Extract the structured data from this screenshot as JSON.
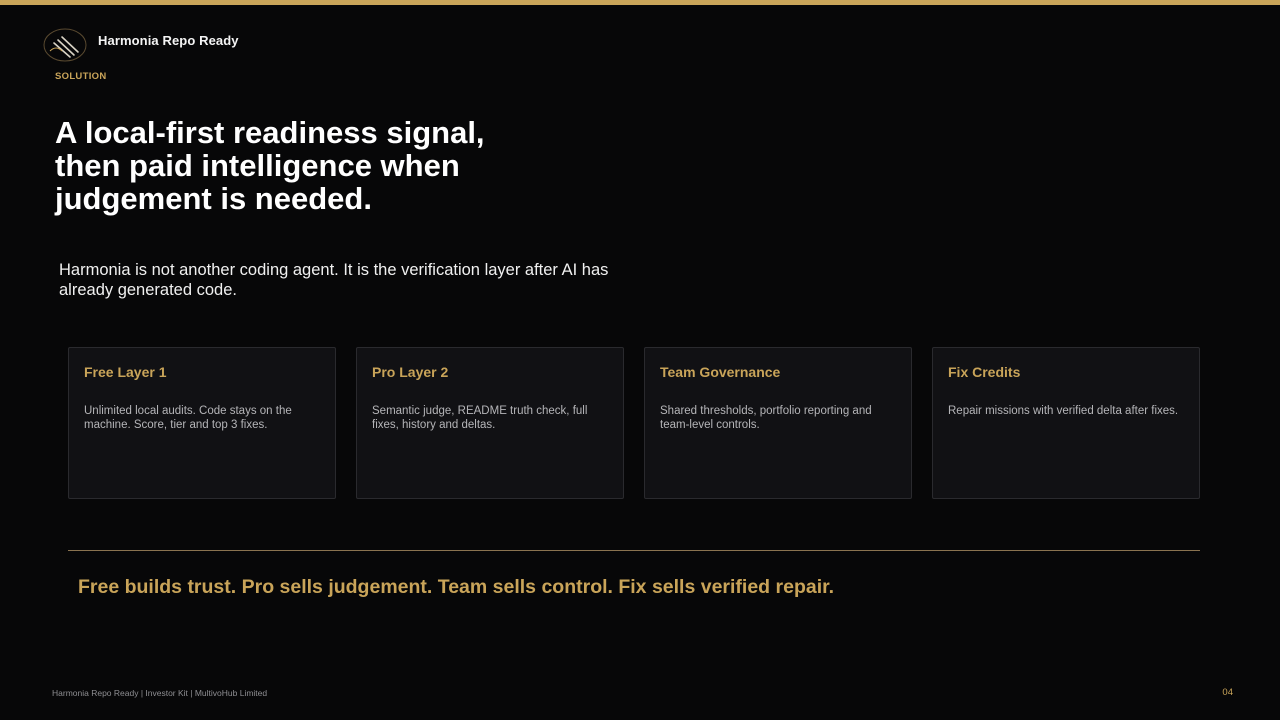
{
  "brand": {
    "name": "Harmonia Repo Ready",
    "logo_icon": "harmonia-lines-logo-icon"
  },
  "eyebrow": "SOLUTION",
  "headline": "A local-first readiness signal, then paid intelligence when judgement is needed.",
  "intro": "Harmonia is not another coding agent. It is the verification layer after AI has already generated code.",
  "cards": [
    {
      "title": "Free Layer 1",
      "body": "Unlimited local audits. Code stays on the machine. Score, tier and top 3 fixes."
    },
    {
      "title": "Pro Layer 2",
      "body": "Semantic judge, README truth check, full fixes, history and deltas."
    },
    {
      "title": "Team Governance",
      "body": "Shared thresholds, portfolio reporting and team-level controls."
    },
    {
      "title": "Fix Credits",
      "body": "Repair missions with verified delta after fixes."
    }
  ],
  "tagline": "Free builds trust. Pro sells judgement. Team sells control. Fix sells verified repair.",
  "footer": {
    "text": "Harmonia Repo Ready | Investor Kit | MultivoHub Limited",
    "page_number": "04"
  },
  "colors": {
    "background": "#070708",
    "accent": "#c9a459",
    "card_background": "#111114",
    "card_border": "#2a2a2e"
  }
}
